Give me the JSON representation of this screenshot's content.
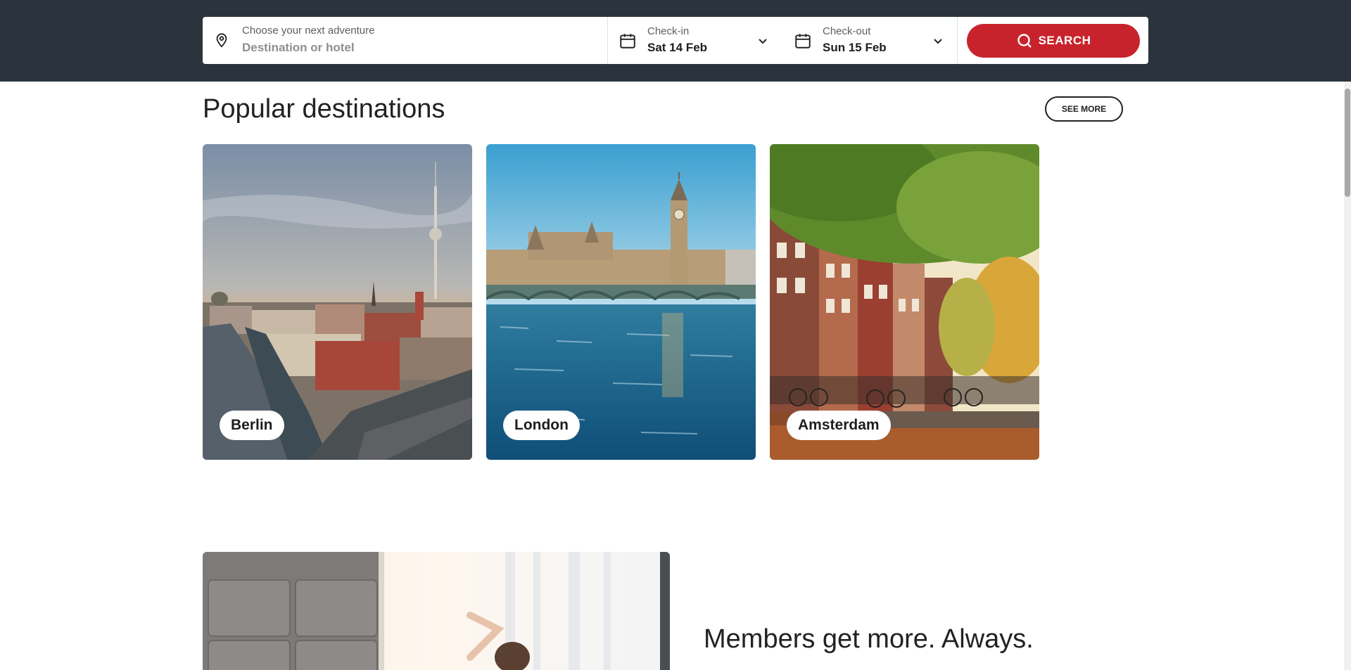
{
  "search": {
    "destination_label": "Choose your next adventure",
    "destination_placeholder": "Destination or hotel",
    "checkin_label": "Check-in",
    "checkin_value": "Sat 14 Feb",
    "checkout_label": "Check-out",
    "checkout_value": "Sun 15 Feb",
    "button_label": "SEARCH"
  },
  "popular": {
    "title": "Popular destinations",
    "see_more": "SEE MORE",
    "cities": [
      {
        "name": "Berlin"
      },
      {
        "name": "London"
      },
      {
        "name": "Amsterdam"
      }
    ]
  },
  "members": {
    "title": "Members get more. Always."
  },
  "colors": {
    "header_bg": "#2b343c",
    "accent": "#c8232c"
  }
}
